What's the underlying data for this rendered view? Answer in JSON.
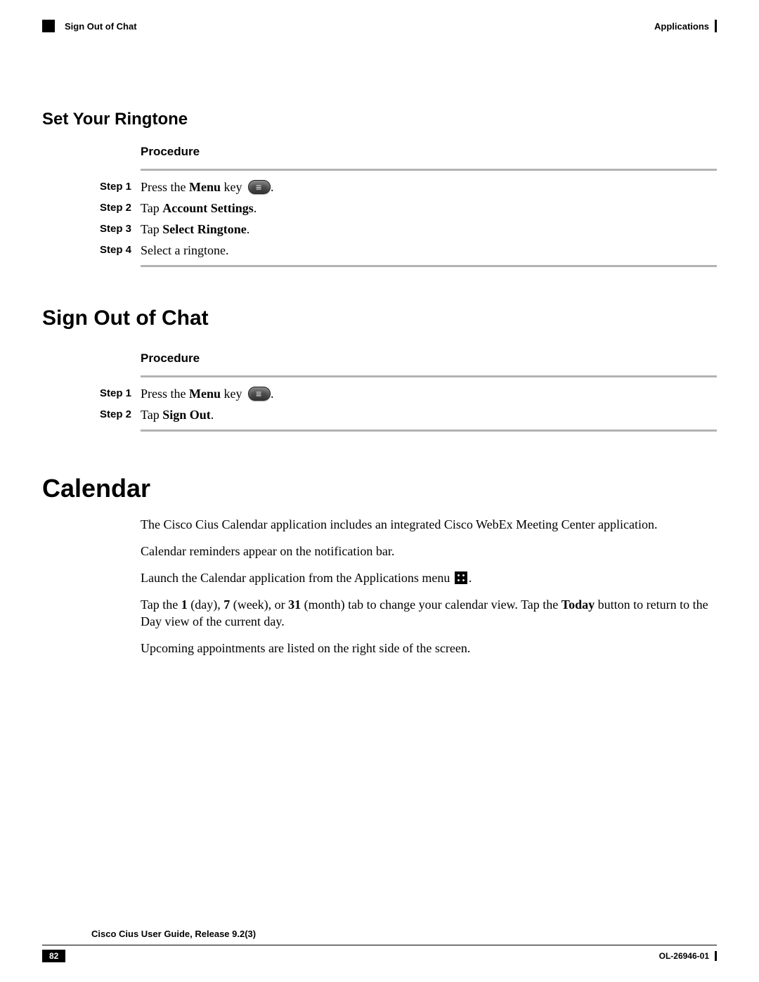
{
  "header": {
    "left": "Sign Out of Chat",
    "right": "Applications"
  },
  "sections": {
    "ringtone": {
      "title": "Set Your Ringtone",
      "proc": "Procedure",
      "steps": {
        "s1": {
          "label": "Step 1",
          "prefix": "Press the ",
          "b1": "Menu",
          "suffix1": " key ",
          "suffix2": "."
        },
        "s2": {
          "label": "Step 2",
          "prefix": "Tap ",
          "b1": "Account Settings",
          "suffix": "."
        },
        "s3": {
          "label": "Step 3",
          "prefix": "Tap ",
          "b1": "Select Ringtone",
          "suffix": "."
        },
        "s4": {
          "label": "Step 4",
          "text": "Select a ringtone."
        }
      }
    },
    "signout": {
      "title": "Sign Out of Chat",
      "proc": "Procedure",
      "steps": {
        "s1": {
          "label": "Step 1",
          "prefix": "Press the ",
          "b1": "Menu",
          "suffix1": " key ",
          "suffix2": "."
        },
        "s2": {
          "label": "Step 2",
          "prefix": "Tap ",
          "b1": "Sign Out",
          "suffix": "."
        }
      }
    },
    "calendar": {
      "title": "Calendar",
      "p1": "The Cisco Cius Calendar application includes an integrated Cisco WebEx Meeting Center application.",
      "p2": "Calendar reminders appear on the notification bar.",
      "p3_prefix": "Launch the Calendar application from the Applications menu ",
      "p3_suffix": ".",
      "p4_a": "Tap the ",
      "p4_b1": "1",
      "p4_c": " (day), ",
      "p4_b2": "7",
      "p4_d": " (week), or ",
      "p4_b3": "31",
      "p4_e": " (month) tab to change your calendar view. Tap the ",
      "p4_b4": "Today",
      "p4_f": " button to return to the Day view of the current day.",
      "p5": "Upcoming appointments are listed on the right side of the screen."
    }
  },
  "footer": {
    "title": "Cisco Cius User Guide, Release 9.2(3)",
    "page": "82",
    "doc": "OL-26946-01"
  }
}
